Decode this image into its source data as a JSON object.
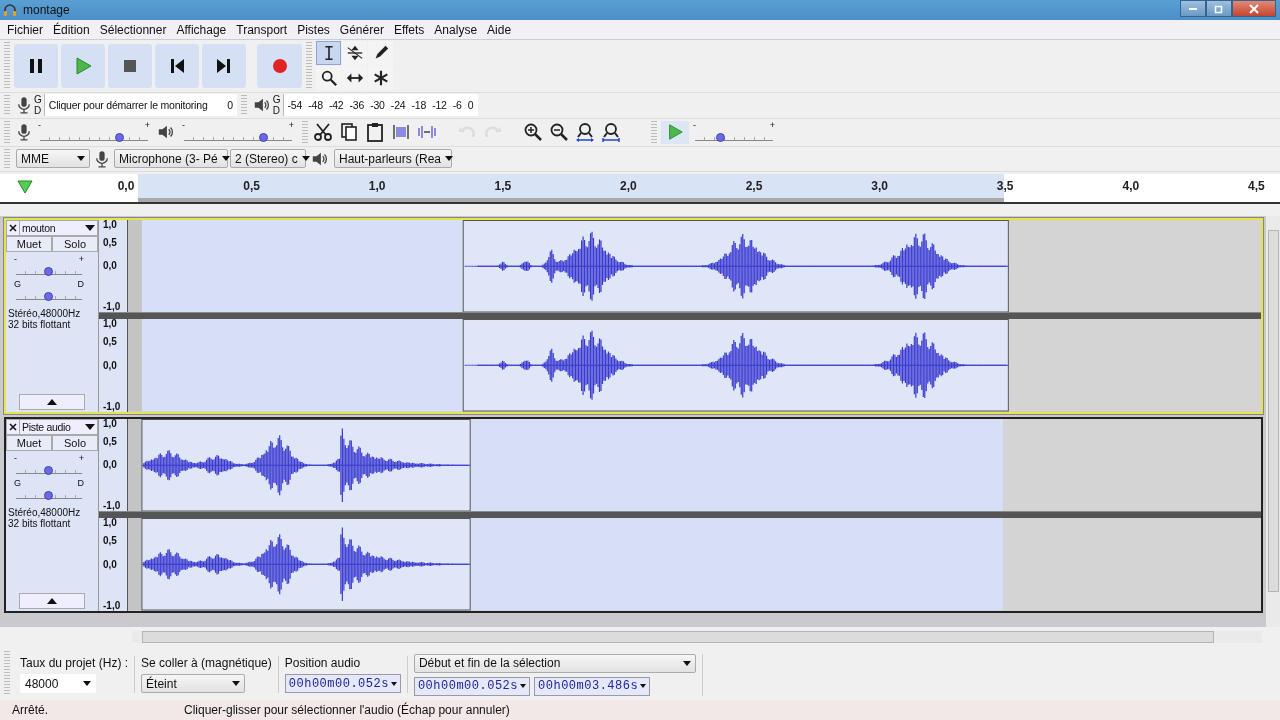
{
  "window": {
    "title": "montage"
  },
  "menu": [
    "Fichier",
    "Édition",
    "Sélectionner",
    "Affichage",
    "Transport",
    "Pistes",
    "Générer",
    "Effets",
    "Analyse",
    "Aide"
  ],
  "transport": [
    {
      "kind": "pause"
    },
    {
      "kind": "play"
    },
    {
      "kind": "stop"
    },
    {
      "kind": "start"
    },
    {
      "kind": "end"
    },
    {
      "kind": "record"
    }
  ],
  "tools": [
    {
      "kind": "select",
      "selected": true
    },
    {
      "kind": "envelope",
      "selected": false
    },
    {
      "kind": "draw",
      "selected": false
    },
    {
      "kind": "zoom",
      "selected": false
    },
    {
      "kind": "timeshift",
      "selected": false
    },
    {
      "kind": "multi",
      "selected": false
    }
  ],
  "recording_meter": {
    "channels": [
      "G",
      "D"
    ],
    "hint": "Cliquer pour démarrer le monitoring",
    "end": "0"
  },
  "playback_meter": {
    "channels": [
      "G",
      "D"
    ],
    "scale": [
      "-54",
      "-48",
      "-42",
      "-36",
      "-30",
      "-24",
      "-18",
      "-12",
      "-6",
      "0"
    ]
  },
  "mixer": [
    {
      "kind": "recording",
      "minus": "-",
      "plus": "+",
      "level": 0.74
    },
    {
      "kind": "playback",
      "minus": "-",
      "plus": "+",
      "level": 0.74
    }
  ],
  "edit": [
    {
      "kind": "cut",
      "disabled": false
    },
    {
      "kind": "copy",
      "disabled": false
    },
    {
      "kind": "paste",
      "disabled": false
    },
    {
      "kind": "trim",
      "disabled": false
    },
    {
      "kind": "silence",
      "disabled": false
    },
    {
      "kind": "undo",
      "disabled": true
    },
    {
      "kind": "redo",
      "disabled": true
    },
    {
      "kind": "zoomin",
      "disabled": false
    },
    {
      "kind": "zoomout",
      "disabled": false
    },
    {
      "kind": "fitsel",
      "disabled": false
    },
    {
      "kind": "fitproj",
      "disabled": false
    }
  ],
  "play_at_speed": {
    "minus": "-",
    "plus": "+",
    "level": 0.33
  },
  "devices": {
    "host": "MME",
    "microphone": "Microphone (3- Pé",
    "channels": "2 (Stereo) c",
    "output": "Haut-parleurs (Rea"
  },
  "ruler": {
    "labels": [
      "0,0",
      "0,5",
      "1,0",
      "1,5",
      "2,0",
      "2,5",
      "3,0",
      "3,5",
      "4,0",
      "4,5"
    ]
  },
  "tracks": [
    {
      "name": "mouton",
      "selected": true,
      "mute": "Muet",
      "solo": "Solo",
      "gain": {
        "minus": "-",
        "plus": "+",
        "level": 0.5
      },
      "pan": {
        "left": "G",
        "right": "D",
        "level": 0.5
      },
      "info": [
        "Stéréo,48000Hz",
        "32 bits flottant"
      ],
      "channels": [
        {
          "scale": [
            "1,0",
            "0,5",
            "0,0",
            "-1,0"
          ]
        },
        {
          "scale": [
            "1,0",
            "0,5",
            "0,0",
            "-1,0"
          ]
        }
      ]
    },
    {
      "name": "Piste audio",
      "selected": false,
      "mute": "Muet",
      "solo": "Solo",
      "gain": {
        "minus": "-",
        "plus": "+",
        "level": 0.5
      },
      "pan": {
        "left": "G",
        "right": "D",
        "level": 0.5
      },
      "info": [
        "Stéréo,48000Hz",
        "32 bits flottant"
      ],
      "channels": [
        {
          "scale": [
            "1,0",
            "0,5",
            "0,0",
            "-1,0"
          ]
        },
        {
          "scale": [
            "1,0",
            "0,5",
            "0,0",
            "-1,0"
          ]
        }
      ]
    }
  ],
  "selection_bar": {
    "rate_label": "Taux du projet (Hz) :",
    "rate": "48000",
    "snap_label": "Se coller à (magnétique)",
    "snap": "Éteint",
    "position_label": "Position audio",
    "position": "00h00m00.052s",
    "mode": "Début et fin de la sélection",
    "start": "00h00m00.052s",
    "end": "00h00m03.486s"
  },
  "status": {
    "state": "Arrêté.",
    "hint": "Cliquer-glisser pour sélectionner l'audio (Échap pour annuler)"
  }
}
